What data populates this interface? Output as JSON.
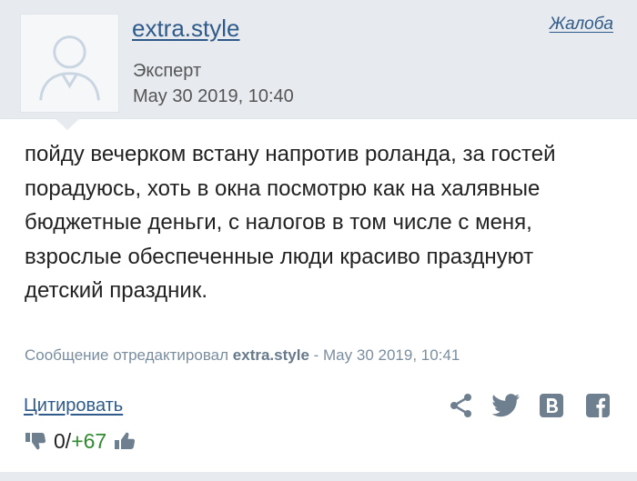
{
  "post": {
    "username": "extra.style",
    "role": "Эксперт",
    "date": "May 30 2019, 10:40",
    "complaint_label": "Жалоба",
    "body": "пойду вечерком встану напротив роланда, за гостей порадуюсь, хоть в окна посмотрю как на халявные бюджетные деньги, с налогов в том числе с меня, взрослые обеспеченные люди красиво празднуют детский праздник.",
    "edited_prefix": "Сообщение отредактировал",
    "edited_user": "extra.style",
    "edited_suffix": "- May 30 2019, 10:41"
  },
  "actions": {
    "quote_label": "Цитировать",
    "share_icons": [
      "share-icon",
      "twitter-icon",
      "vk-icon",
      "facebook-icon"
    ]
  },
  "rating": {
    "down": "0",
    "separator": "/",
    "up": "+67"
  },
  "colors": {
    "header_bg": "#e7ebef",
    "link": "#2f5a8a",
    "icon": "#6e7f8f",
    "positive": "#2e8a2e"
  }
}
